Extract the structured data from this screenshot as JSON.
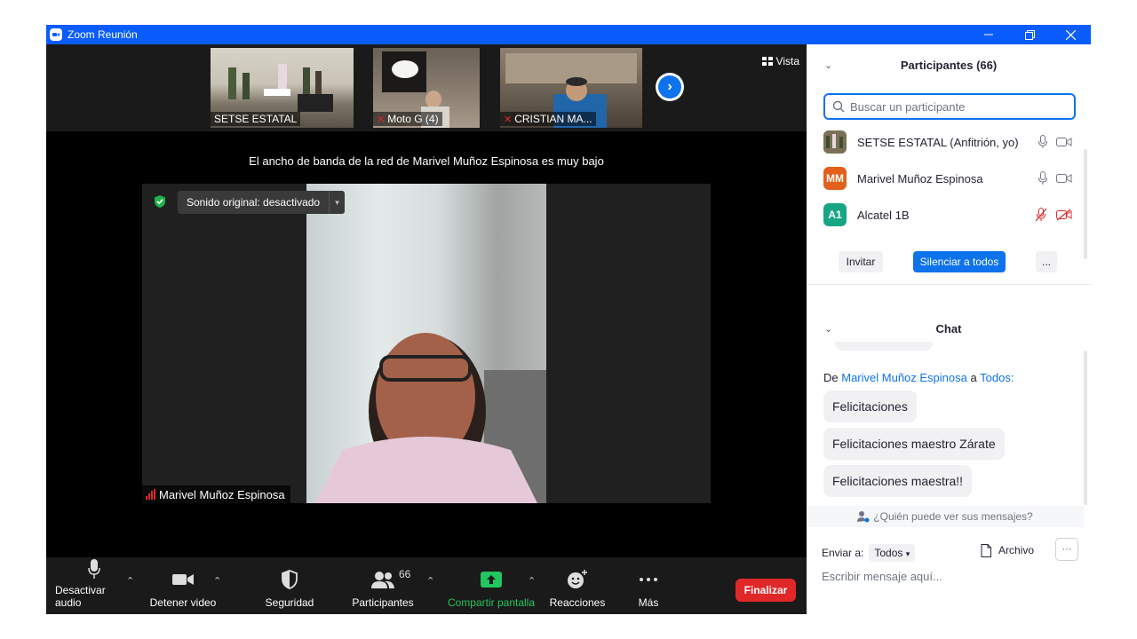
{
  "window": {
    "title": "Zoom Reunión",
    "controls": [
      "minimize-icon",
      "restore-icon",
      "close-icon"
    ]
  },
  "gallery": {
    "thumbnails": [
      {
        "name": "SETSE ESTATAL",
        "muted": false
      },
      {
        "name": "Moto G (4)",
        "muted": true
      },
      {
        "name": "CRISTIAN MA...",
        "muted": true
      }
    ],
    "view_label": "Vista"
  },
  "banner": "El ancho de banda de la red de Marivel Muñoz Espinosa es muy bajo",
  "main_video": {
    "original_sound": "Sonido original: desactivado",
    "speaker": "Marivel Muñoz Espinosa"
  },
  "toolbar": {
    "audio": "Desactivar audio",
    "video": "Detener video",
    "security": "Seguridad",
    "participants": "Participantes",
    "participants_count": "66",
    "share": "Compartir pantalla",
    "reactions": "Reacciones",
    "more": "Más",
    "end": "Finalizar"
  },
  "participants_panel": {
    "header": "Participantes (66)",
    "search_placeholder": "Buscar un participante",
    "list": [
      {
        "name": "SETSE ESTATAL (Anfitrión, yo)",
        "initials": "",
        "color": "#6b6b50",
        "muted": false,
        "video_off": false
      },
      {
        "name": "Marivel Muñoz Espinosa",
        "initials": "MM",
        "color": "#e1601b",
        "muted": false,
        "video_off": false
      },
      {
        "name": "Alcatel 1B",
        "initials": "A1",
        "color": "#18a584",
        "muted": true,
        "video_off": true
      }
    ],
    "invite": "Invitar",
    "mute_all": "Silenciar a todos",
    "more": "..."
  },
  "chat": {
    "header": "Chat",
    "from_prefix": "De",
    "from_name": "Marivel Muñoz Espinosa",
    "to_word": "a",
    "to_name": "Todos:",
    "messages": [
      "Felicitaciones",
      "Felicitaciones maestro Zárate",
      "Felicitaciones maestra!!"
    ],
    "who_sees": "¿Quién puede ver sus mensajes?",
    "send_to_label": "Enviar a:",
    "send_to_value": "Todos",
    "file_label": "Archivo",
    "input_placeholder": "Escribir mensaje aquí..."
  },
  "colors": {
    "accent": "#0e72ed",
    "titlebar": "#0b5cff",
    "end": "#e02828",
    "share": "#22c55e"
  }
}
